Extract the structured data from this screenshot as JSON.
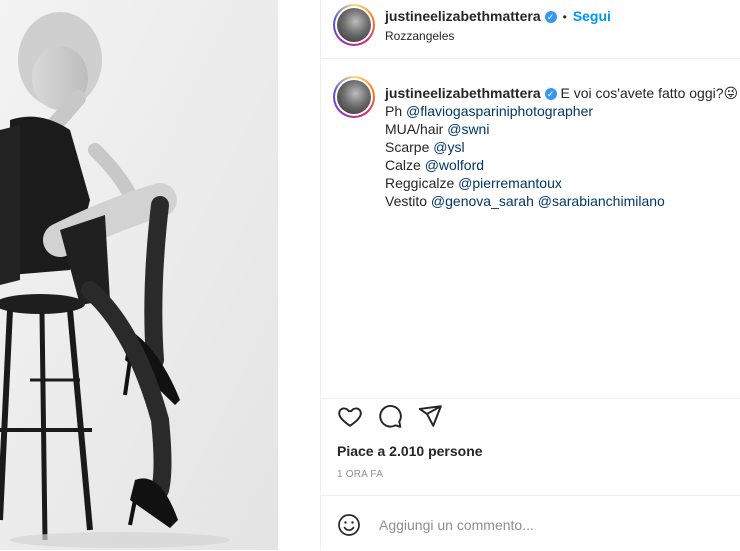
{
  "post": {
    "username": "justineelizabethmattera",
    "follow_label": "Segui",
    "location": "Rozzangeles",
    "caption": {
      "text": "E voi cos'avete fatto oggi?",
      "emoji": "😜",
      "lines": [
        {
          "label": "Ph ",
          "mentions": [
            "@flaviogaspariniphotographer"
          ]
        },
        {
          "label": "MUA/hair ",
          "mentions": [
            "@swni"
          ]
        },
        {
          "label": "Scarpe ",
          "mentions": [
            "@ysl"
          ]
        },
        {
          "label": "Calze ",
          "mentions": [
            "@wolford"
          ]
        },
        {
          "label": "Reggicalze ",
          "mentions": [
            "@pierremantoux"
          ]
        },
        {
          "label": "Vestito ",
          "mentions": [
            "@genova_sarah",
            "@sarabianchimilano"
          ]
        }
      ]
    },
    "likes": "Piace a 2.010 persone",
    "timestamp": "1 ORA FA",
    "comment_placeholder": "Aggiungi un commento..."
  },
  "icons": {
    "like": "heart-icon",
    "comment": "comment-icon",
    "share": "paper-plane-icon",
    "emoji": "smiley-icon",
    "verified": "verified-badge-icon"
  },
  "colors": {
    "link_blue": "#0095f6",
    "mention": "#00376b",
    "verified": "#3897f0",
    "muted": "#8e8e8e"
  }
}
